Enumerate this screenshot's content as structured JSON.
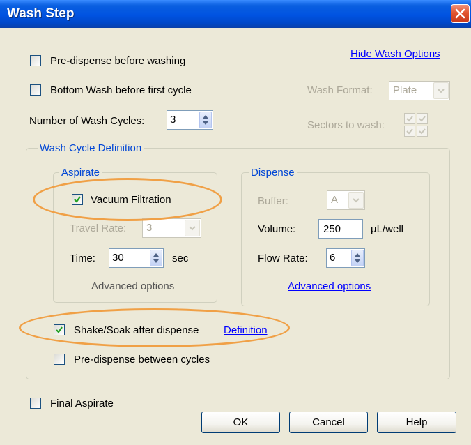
{
  "window": {
    "title": "Wash Step"
  },
  "top_options": {
    "pre_dispense_label": "Pre-dispense before washing",
    "pre_dispense_checked": false,
    "bottom_wash_label": "Bottom Wash before first cycle",
    "bottom_wash_checked": false,
    "hide_wash_options_link": "Hide Wash Options",
    "wash_cycles_label": "Number of Wash Cycles:",
    "wash_cycles_value": "3",
    "wash_format_label": "Wash Format:",
    "wash_format_value": "Plate",
    "sectors_label": "Sectors to wash:"
  },
  "wash_cycle_definition": {
    "title": "Wash Cycle Definition",
    "aspirate": {
      "title": "Aspirate",
      "vacuum_filtration_label": "Vacuum Filtration",
      "vacuum_filtration_checked": true,
      "travel_rate_label": "Travel Rate:",
      "travel_rate_value": "3",
      "time_label": "Time:",
      "time_value": "30",
      "time_unit": "sec",
      "advanced_options": "Advanced options"
    },
    "dispense": {
      "title": "Dispense",
      "buffer_label": "Buffer:",
      "buffer_value": "A",
      "volume_label": "Volume:",
      "volume_value": "250",
      "volume_unit": "µL/well",
      "flow_rate_label": "Flow Rate:",
      "flow_rate_value": "6",
      "advanced_options_link": "Advanced options"
    },
    "shake_soak_label": "Shake/Soak after dispense",
    "shake_soak_checked": true,
    "definition_link": "Definition",
    "pre_dispense_between_label": "Pre-dispense between cycles",
    "pre_dispense_between_checked": false
  },
  "bottom": {
    "final_aspirate_label": "Final Aspirate",
    "final_aspirate_checked": false,
    "ok_label": "OK",
    "cancel_label": "Cancel",
    "help_label": "Help"
  },
  "colors": {
    "titlebar": "#0053e1",
    "dialog_bg": "#ece9d8",
    "group_title": "#0046d5",
    "highlight_ellipse": "#f0a046",
    "link": "#0000ff"
  }
}
